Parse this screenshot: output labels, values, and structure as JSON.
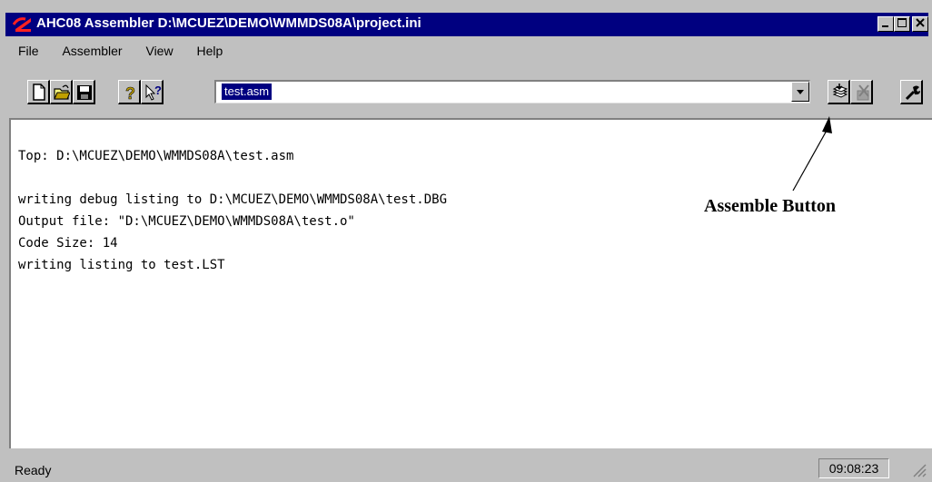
{
  "window": {
    "title": "AHC08 Assembler  D:\\MCUEZ\\DEMO\\WMMDS08A\\project.ini",
    "colors": {
      "titlebar": "#000080",
      "chrome": "#c0c0c0",
      "selection": "#000080"
    }
  },
  "menu": {
    "items": [
      {
        "label": "File"
      },
      {
        "label": "Assembler"
      },
      {
        "label": "View"
      },
      {
        "label": "Help"
      }
    ]
  },
  "toolbar": {
    "buttons": [
      {
        "icon": "new-file-icon"
      },
      {
        "icon": "open-folder-icon"
      },
      {
        "icon": "save-disk-icon"
      },
      {
        "icon": "help-icon"
      },
      {
        "icon": "context-help-icon"
      },
      {
        "icon": "assemble-icon"
      },
      {
        "icon": "stop-icon"
      },
      {
        "icon": "options-wrench-icon"
      }
    ],
    "file_combo_value": "test.asm"
  },
  "output": {
    "lines": [
      "Top: D:\\MCUEZ\\DEMO\\WMMDS08A\\test.asm",
      "",
      "writing debug listing to D:\\MCUEZ\\DEMO\\WMMDS08A\\test.DBG",
      "Output file: \"D:\\MCUEZ\\DEMO\\WMMDS08A\\test.o\"",
      "Code Size: 14",
      "writing listing to test.LST"
    ]
  },
  "annotation": {
    "label": "Assemble Button"
  },
  "status": {
    "text": "Ready",
    "time": "09:08:23"
  }
}
